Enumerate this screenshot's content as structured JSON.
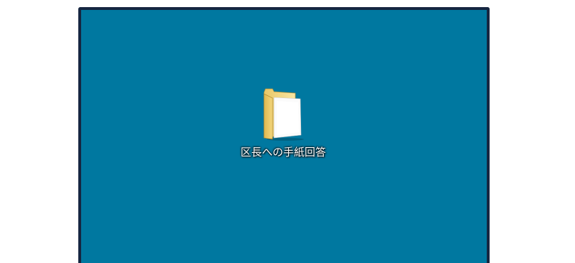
{
  "desktop": {
    "background_color": "#0078a0",
    "frame_color": "#162641",
    "icons": [
      {
        "icon": "folder-icon",
        "label": "区長への手紙回答"
      }
    ]
  }
}
